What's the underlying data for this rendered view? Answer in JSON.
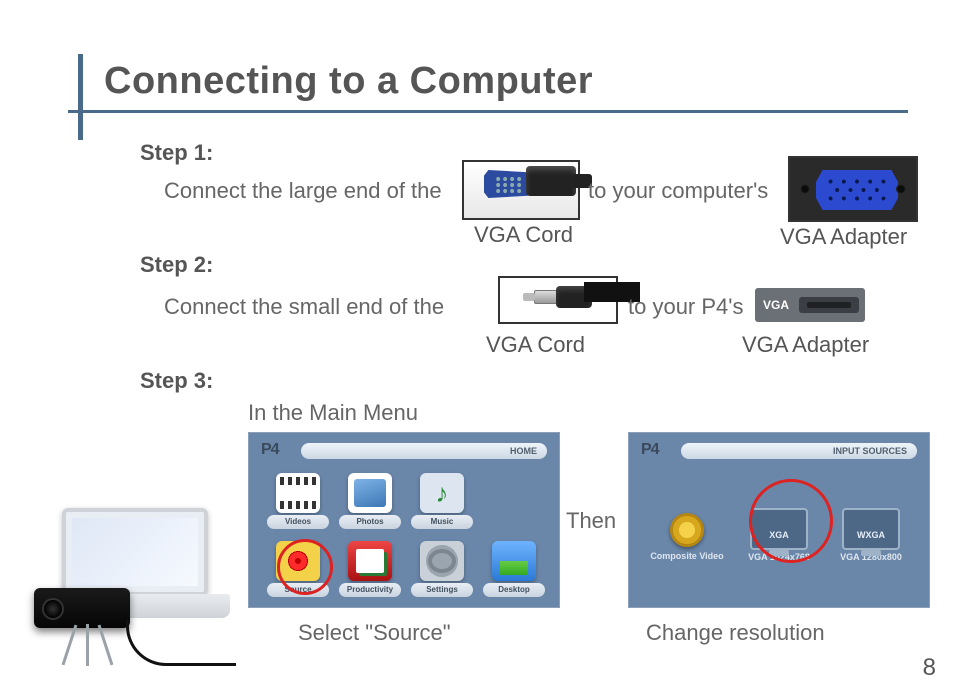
{
  "title": "Connecting to a Computer",
  "page_number": "8",
  "step1": {
    "label": "Step 1:",
    "text_a": "Connect the large end of the",
    "text_b": "to your computer's",
    "caption_a": "VGA Cord",
    "caption_b": "VGA Adapter"
  },
  "step2": {
    "label": "Step 2:",
    "text_a": "Connect the small end of the",
    "text_b": "to your P4's",
    "caption_a": "VGA Cord",
    "caption_b": "VGA Adapter",
    "port_tag": "VGA"
  },
  "step3": {
    "label": "Step 3:",
    "intro": "In the Main Menu",
    "then": "Then",
    "caption_left": "Select \"Source\"",
    "caption_right": "Change resolution"
  },
  "home_screen": {
    "logo": "P4",
    "header": "HOME",
    "tiles": [
      {
        "label": "Videos",
        "icon": "videos"
      },
      {
        "label": "Photos",
        "icon": "photos"
      },
      {
        "label": "Music",
        "icon": "music"
      },
      {
        "label": "",
        "icon": ""
      },
      {
        "label": "Source",
        "icon": "source"
      },
      {
        "label": "Productivity",
        "icon": "prod"
      },
      {
        "label": "Settings",
        "icon": "settings"
      },
      {
        "label": "Desktop",
        "icon": "desktop"
      }
    ]
  },
  "source_screen": {
    "logo": "P4",
    "header": "INPUT SOURCES",
    "items": [
      {
        "title": "Composite Video",
        "tag": ""
      },
      {
        "title": "VGA 1024x768",
        "tag": "XGA"
      },
      {
        "title": "VGA 1280x800",
        "tag": "WXGA"
      }
    ]
  }
}
